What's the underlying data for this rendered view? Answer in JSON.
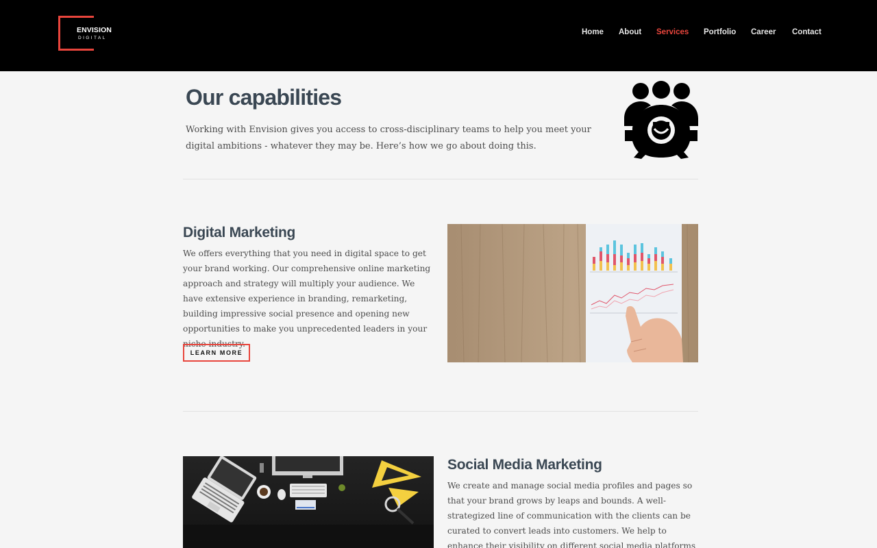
{
  "header": {
    "logo_word": "ENVISION",
    "logo_sub": "DIGITAL",
    "nav": [
      {
        "label": "Home",
        "active": false
      },
      {
        "label": "About",
        "active": false
      },
      {
        "label": "Services",
        "active": true
      },
      {
        "label": "Portfolio",
        "active": false
      },
      {
        "label": "Career",
        "active": false
      },
      {
        "label": "Contact",
        "active": false
      }
    ]
  },
  "intro": {
    "title": "Our capabilities",
    "text": "Working with Envision gives you access to cross-disciplinary teams to help you meet your digital ambitions - whatever they may be. Here’s how we go about doing this.",
    "icon": "team-gear-icon"
  },
  "sections": [
    {
      "title": "Digital Marketing",
      "text": "We offers everything that you need in digital space to get your brand working. Our comprehensive online marketing approach and strategy will multiply your audience. We have extensive experience in branding, remarketing, building impressive social presence and opening new opportunities to make you unprecedented leaders in your niche industry.",
      "button": "LEARN MORE",
      "image": "hand-pointing-at-printed-charts-on-wooden-desk"
    },
    {
      "title": "Social Media Marketing",
      "text": "We create and manage social media profiles and pages so that your brand grows by leaps and bounds. A well-strategized line of communication with the clients can be curated to convert leads into customers. We help to enhance their visibility on different social media platforms including Facebook, LinkedIn",
      "image": "dark-desk-with-laptop-monitor-and-drafting-tools"
    }
  ],
  "colors": {
    "accent": "#e8453c",
    "header_bg": "#000000",
    "heading": "#3a4753",
    "page_bg": "#f5f5f5"
  }
}
